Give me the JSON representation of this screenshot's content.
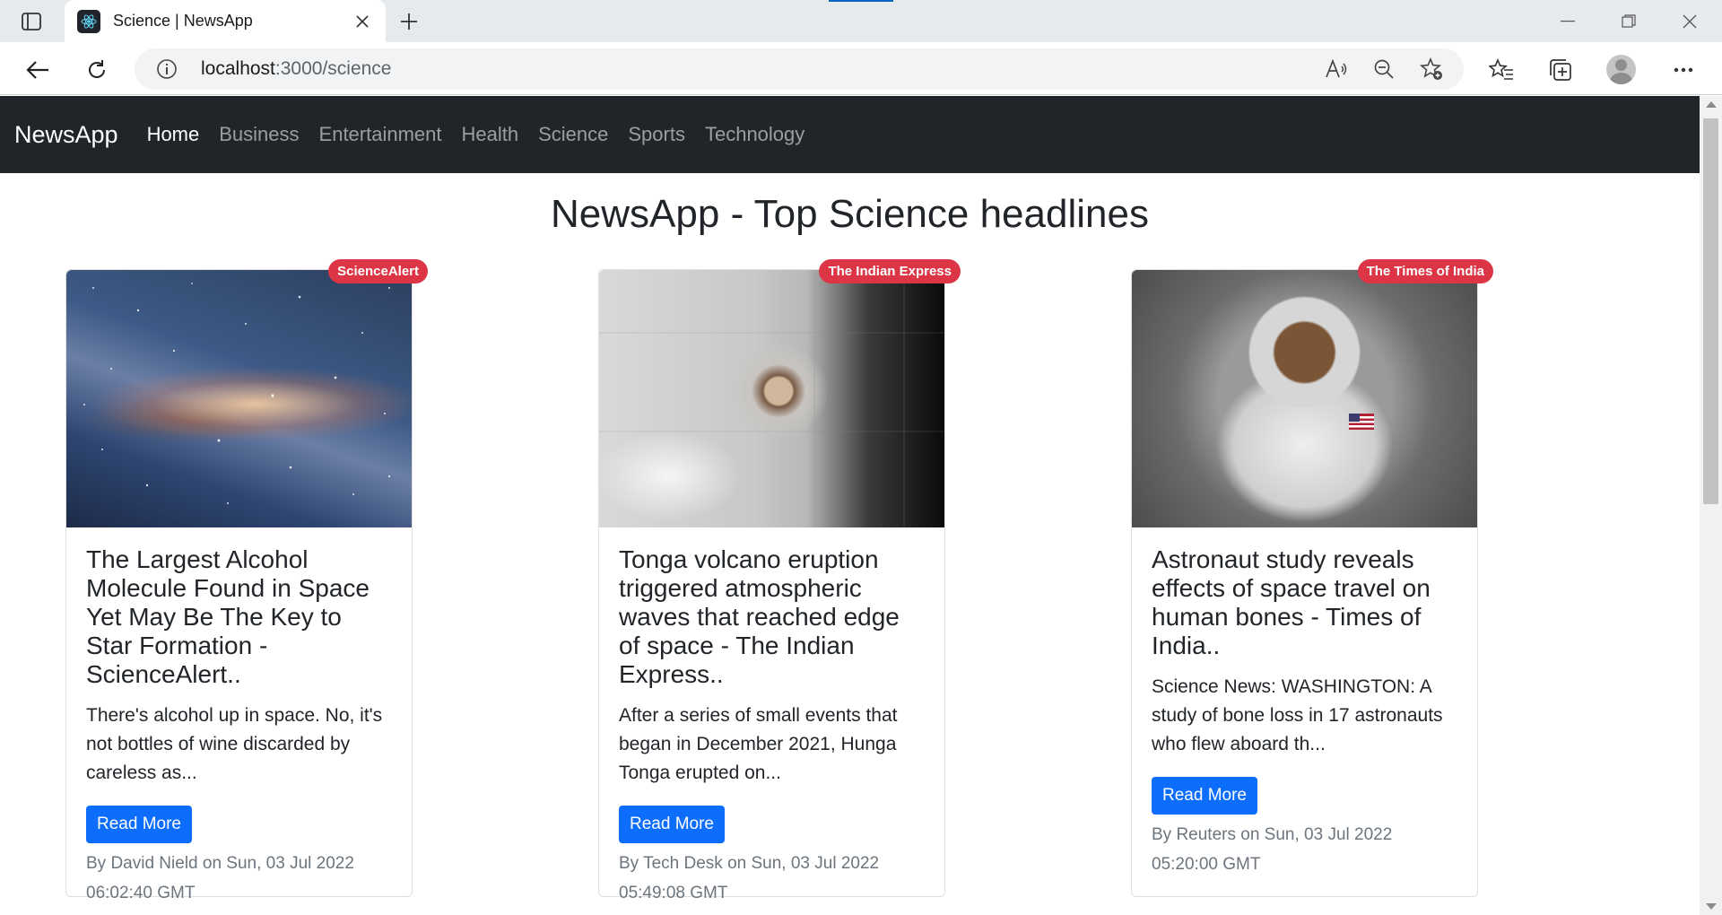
{
  "browser": {
    "tab_title": "Science | NewsApp",
    "url_host": "localhost",
    "url_path": ":3000/science"
  },
  "navbar": {
    "brand": "NewsApp",
    "links": [
      {
        "label": "Home",
        "active": true
      },
      {
        "label": "Business",
        "active": false
      },
      {
        "label": "Entertainment",
        "active": false
      },
      {
        "label": "Health",
        "active": false
      },
      {
        "label": "Science",
        "active": false
      },
      {
        "label": "Sports",
        "active": false
      },
      {
        "label": "Technology",
        "active": false
      }
    ]
  },
  "heading": "NewsApp - Top Science headlines",
  "colors": {
    "navbar_bg": "#212529",
    "badge": "#dc3545",
    "button": "#0d6efd"
  },
  "articles": [
    {
      "source": "ScienceAlert",
      "title": "The Largest Alcohol Molecule Found in Space Yet May Be The Key to Star Formation - ScienceAlert..",
      "description": "There's alcohol up in space. No, it's not bottles of wine discarded by careless as...",
      "button": "Read More",
      "meta": "By David Nield on Sun, 03 Jul 2022 06:02:40 GMT",
      "image": "galaxy"
    },
    {
      "source": "The Indian Express",
      "title": "Tonga volcano eruption triggered atmospheric waves that reached edge of space - The Indian Express..",
      "description": "After a series of small events that began in December 2021, Hunga Tonga erupted on...",
      "button": "Read More",
      "meta": "By Tech Desk on Sun, 03 Jul 2022 05:49:08 GMT",
      "image": "volcano-satellite"
    },
    {
      "source": "The Times of India",
      "title": "Astronaut study reveals effects of space travel on human bones - Times of India..",
      "description": "Science News: WASHINGTON: A study of bone loss in 17 astronauts who flew aboard th...",
      "button": "Read More",
      "meta": "By Reuters on Sun, 03 Jul 2022 05:20:00 GMT",
      "image": "astronaut"
    }
  ]
}
